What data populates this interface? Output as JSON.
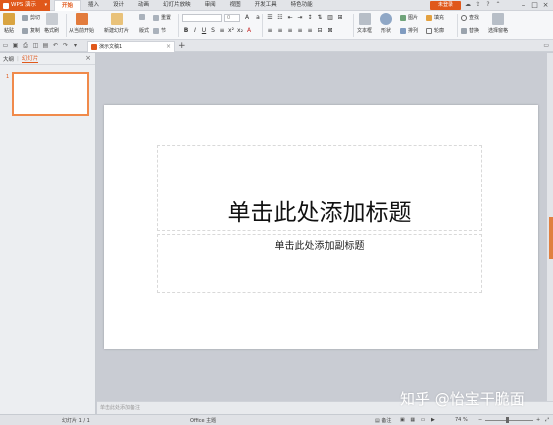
{
  "titlebar": {
    "app_name": "WPS 演示",
    "menu_tabs": [
      "开始",
      "插入",
      "设计",
      "动画",
      "幻灯片放映",
      "审阅",
      "视图",
      "开发工具",
      "特色功能"
    ],
    "active_tab": "开始",
    "login_label": "未登录"
  },
  "ribbon": {
    "paste": "粘贴",
    "cut": "剪切",
    "copy": "复制",
    "format_painter": "格式刷",
    "from_start": "从当前开始",
    "new_slide": "新建幻灯片",
    "layout": "版式",
    "reset": "重置",
    "section": "节",
    "font_size": "0",
    "textbox": "文本框",
    "shape": "形状",
    "picture": "图片",
    "arrange": "排列",
    "fill": "填充",
    "outline": "轮廓",
    "find": "查找",
    "replace": "替换",
    "select_pane": "选择窗格"
  },
  "document": {
    "tab_title": "演示文稿1"
  },
  "left_panel": {
    "outline_tab": "大纲",
    "slides_tab": "幻灯片",
    "thumb_number": "1"
  },
  "slide": {
    "title_placeholder": "单击此处添加标题",
    "subtitle_placeholder": "单击此处添加副标题"
  },
  "notes": {
    "placeholder": "单击此处添加备注"
  },
  "status": {
    "slide_count": "幻灯片 1 / 1",
    "theme": "Office 主题",
    "notes_label": "备注",
    "zoom": "74 %"
  },
  "watermark": "知乎 @怡宝干脆面",
  "colors": {
    "accent": "#e0581a",
    "ribbon_bg": "#f6f7f9",
    "workspace_bg": "#c9ccd3"
  }
}
